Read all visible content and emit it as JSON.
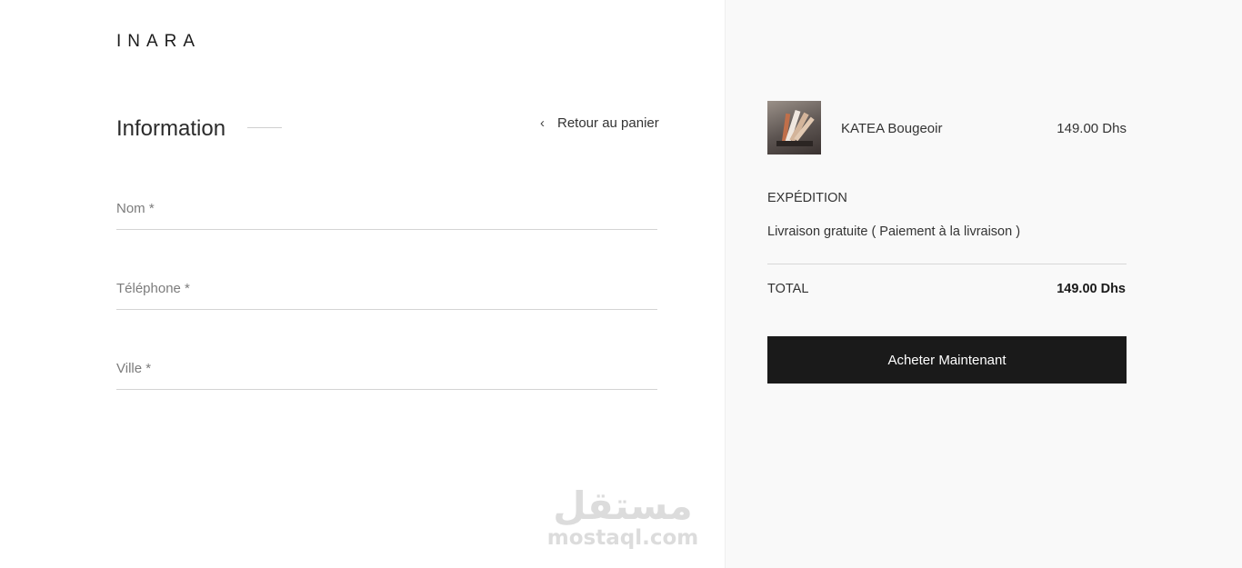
{
  "brand": {
    "logo_text": "INARA"
  },
  "form": {
    "heading": "Information",
    "back_link": "Retour au panier",
    "back_icon": "chevron-left-icon",
    "fields": {
      "nom": {
        "placeholder": "Nom *",
        "value": ""
      },
      "telephone": {
        "placeholder": "Téléphone *",
        "value": ""
      },
      "ville": {
        "placeholder": "Ville *",
        "value": ""
      }
    }
  },
  "summary": {
    "product": {
      "name": "KATEA Bougeoir",
      "price": "149.00 Dhs"
    },
    "shipping": {
      "title": "EXPÉDITION",
      "description": "Livraison gratuite ( Paiement à la livraison )"
    },
    "total": {
      "label": "TOTAL",
      "value": "149.00 Dhs"
    },
    "buy_button": "Acheter Maintenant",
    "button_color": "#1a1a1a",
    "panel_background": "#f9f9f9"
  },
  "watermark": {
    "arabic": "مستقل",
    "latin": "mostaql.com"
  }
}
